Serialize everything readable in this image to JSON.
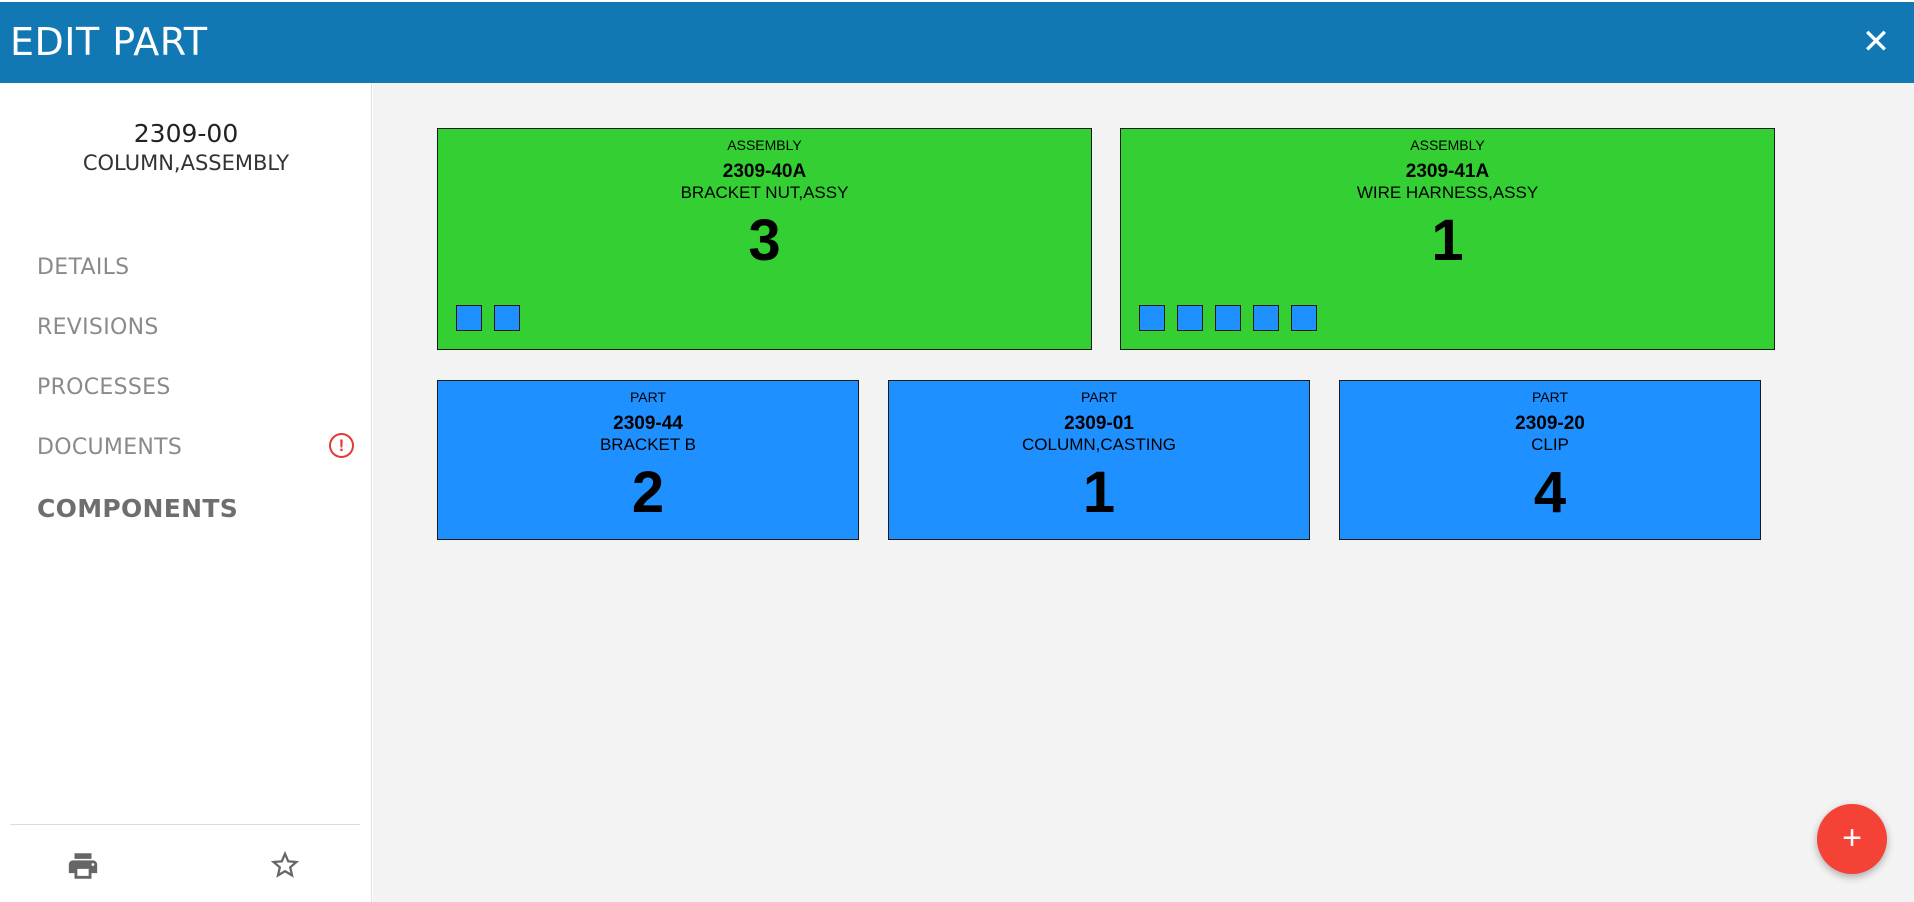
{
  "header": {
    "title": "EDIT PART",
    "close_icon": "close-icon"
  },
  "sidebar": {
    "part_number": "2309-00",
    "part_description": "COLUMN,ASSEMBLY",
    "nav": [
      {
        "label": "DETAILS"
      },
      {
        "label": "REVISIONS"
      },
      {
        "label": "PROCESSES"
      },
      {
        "label": "DOCUMENTS",
        "alert": "!"
      },
      {
        "label": "COMPONENTS",
        "active": true
      }
    ],
    "footer_icons": [
      "print-icon",
      "star-icon"
    ]
  },
  "components": {
    "assemblies": [
      {
        "type": "ASSEMBLY",
        "number": "2309-40A",
        "description": "BRACKET NUT,ASSY",
        "quantity": "3",
        "sub_items": 2
      },
      {
        "type": "ASSEMBLY",
        "number": "2309-41A",
        "description": "WIRE HARNESS,ASSY",
        "quantity": "1",
        "sub_items": 5
      }
    ],
    "parts": [
      {
        "type": "PART",
        "number": "2309-44",
        "description": "BRACKET B",
        "quantity": "2"
      },
      {
        "type": "PART",
        "number": "2309-01",
        "description": "COLUMN,CASTING",
        "quantity": "1"
      },
      {
        "type": "PART",
        "number": "2309-20",
        "description": "CLIP",
        "quantity": "4"
      }
    ]
  },
  "fab": {
    "label": "+"
  },
  "colors": {
    "header": "#1278b4",
    "assembly": "#33cf33",
    "part": "#1e90ff",
    "fab": "#f44336",
    "alert": "#e53935"
  }
}
